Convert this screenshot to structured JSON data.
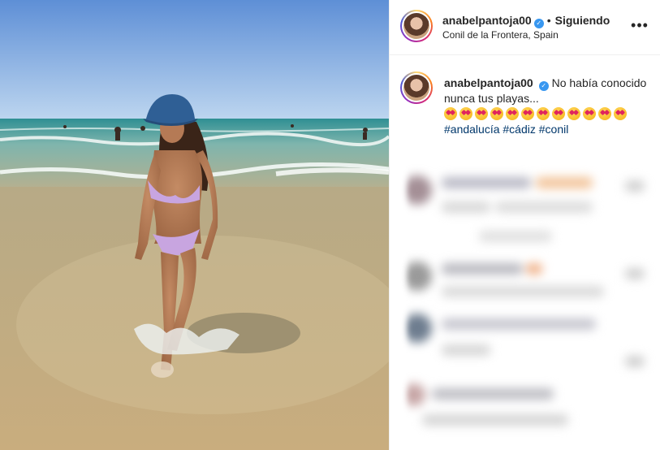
{
  "post": {
    "username": "anabelpantoja00",
    "separator": "•",
    "follow_status": "Siguiendo",
    "location": "Conil de la Frontera, Spain",
    "verified_icon": "✓",
    "more_icon": "•••"
  },
  "caption": {
    "username": "anabelpantoja00",
    "text": "No había conocido nunca tus playas...",
    "emoji_count": 12,
    "emoji_name": "heart-eyes-emoji",
    "hashtags": "#andalucía #cádiz #conil"
  },
  "colors": {
    "sky_top": "#6f9fe0",
    "sky_horizon": "#b9d3ef",
    "sea": "#4a9aa0",
    "sand": "#c8b48a",
    "link": "#00376b",
    "verified": "#3897f0"
  }
}
